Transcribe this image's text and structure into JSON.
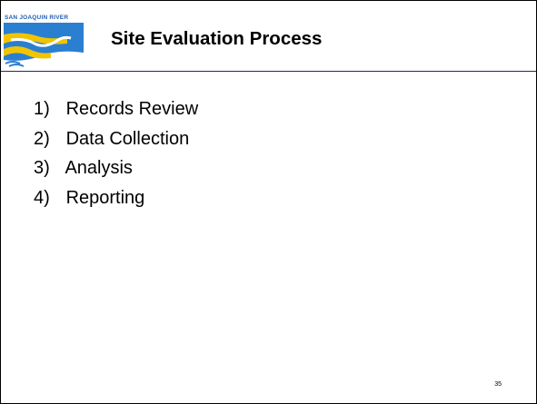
{
  "slide": {
    "logo_text": "SAN JOAQUIN RIVER",
    "title": "Site Evaluation Process",
    "items": [
      {
        "num": "1)",
        "label": "Records Review"
      },
      {
        "num": "2)",
        "label": "Data Collection"
      },
      {
        "num": "3)",
        "label": "Analysis"
      },
      {
        "num": "4)",
        "label": "Reporting"
      }
    ],
    "page_number": "35"
  },
  "colors": {
    "rule": "#1a2f5a",
    "logo_blue": "#1f6fc0",
    "logo_yellow": "#f2c400"
  }
}
